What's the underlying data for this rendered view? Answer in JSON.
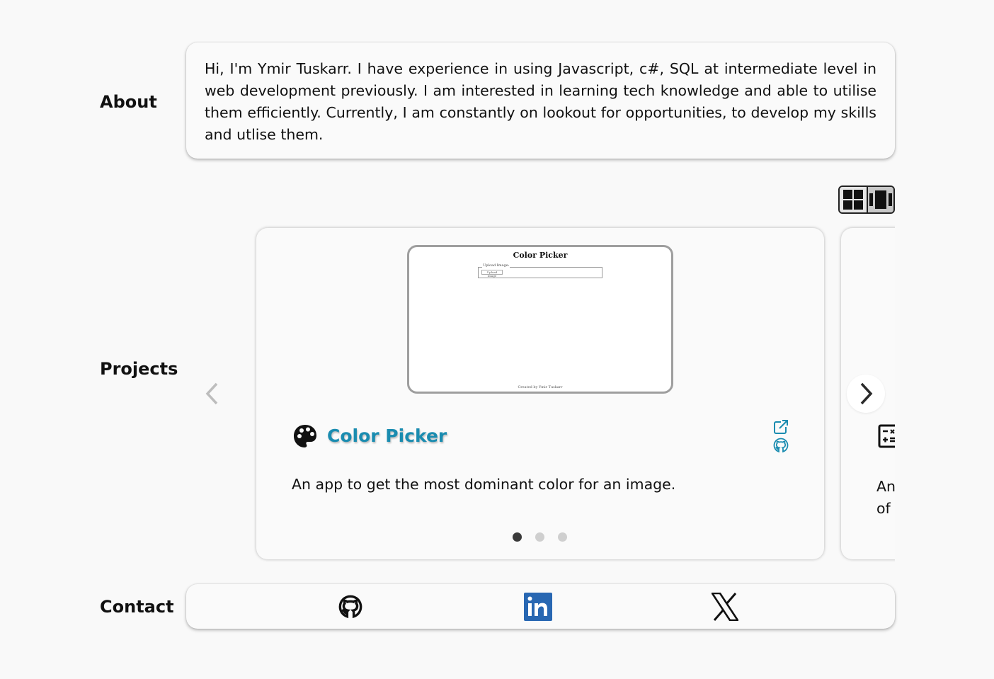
{
  "about": {
    "label": "About",
    "text": "Hi, I'm Ymir Tuskarr. I have experience in using Javascript, c#, SQL at intermediate level in web development previously. I am interested in learning tech knowledge and able to utilise them efficiently. Currently, I am constantly on lookout for opportunities, to develop my skills and utlise them."
  },
  "projects": {
    "label": "Projects",
    "view_toggle": {
      "grid_icon": "grid-view-icon",
      "carousel_icon": "carousel-view-icon",
      "active": "carousel"
    },
    "current": {
      "title": "Color Picker",
      "description": "An app to get the most dominant color for an image.",
      "icon": "palette-icon",
      "title_color": "#1a8cb0",
      "preview": {
        "title": "Color Picker",
        "field_legend": "Upload Image:",
        "button": "Upload image",
        "footer": "Created by Ymir Tuskarr"
      },
      "links": [
        "external-link-icon",
        "github-icon"
      ]
    },
    "next": {
      "icon": "calculator-icon",
      "description_line1": "An",
      "description_line2": "of"
    },
    "pagination": {
      "total": 3,
      "active": 1
    }
  },
  "contact": {
    "label": "Contact",
    "links": [
      "github-icon",
      "linkedin-icon",
      "x-icon"
    ]
  },
  "colors": {
    "accent": "#1a8cb0",
    "linkedin": "#2867b2"
  }
}
